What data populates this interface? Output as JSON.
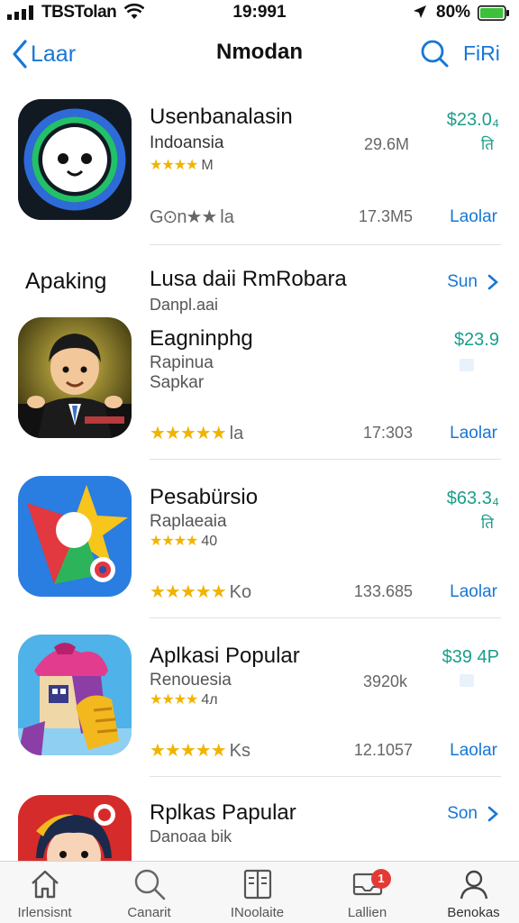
{
  "status_bar": {
    "carrier": "TBSTolan",
    "time": "19:991",
    "battery_percent": "80%",
    "icons": [
      "signal-icon",
      "wifi-icon",
      "location-icon",
      "battery-icon"
    ]
  },
  "nav": {
    "back_label": "Laar",
    "title": "Nmodan",
    "right_label": "FiRi",
    "icons": [
      "chevron-left-icon",
      "search-icon"
    ]
  },
  "apps": [
    {
      "name": "Usenbanalasin",
      "subtitle": "Indoansia",
      "rating_line": "★★★★",
      "rating_suffix": "M",
      "size_top": "29.6M",
      "price": "$23.0₄",
      "price_sub": "ति",
      "bottom_rating_stars": "G⊙n★★",
      "bottom_rating_suffix": "la",
      "size": "17.3M5",
      "action": "Laolar"
    },
    {
      "name": "Eagninphg",
      "subtitle": "Rapinua",
      "subtitle2": "Sapkar",
      "price": "$23.9",
      "bottom_rating_stars": "★★★★★",
      "bottom_rating_suffix": "la",
      "size": "17:303",
      "action": "Laolar"
    },
    {
      "name": "Pesabürsio",
      "subtitle": "Raplaeaia",
      "rating_line": "★★★★",
      "rating_suffix": "40",
      "price": "$63.3₄",
      "price_sub": "ति",
      "bottom_rating_stars": "★★★★★",
      "bottom_rating_suffix": "Ko",
      "size": "133.685",
      "action": "Laolar"
    },
    {
      "name": "Aplkasi Popular",
      "subtitle": "Renouesia",
      "rating_line": "★★★★",
      "rating_suffix": "4л",
      "size_top": "3920k",
      "price": "$39 4P",
      "bottom_rating_stars": "★★★★★",
      "bottom_rating_suffix": "Ks",
      "size": "12.1057",
      "action": "Laolar"
    },
    {
      "name": "Rplkas Papular",
      "subtitle": "Danoaa bik",
      "action": "Son"
    }
  ],
  "section": {
    "label": "Apaking",
    "name": "Lusa daii RmRobara",
    "subtitle": "Danpl.aai",
    "action": "Sun"
  },
  "tabs": [
    {
      "label": "Irlensisnt",
      "icon": "house-icon"
    },
    {
      "label": "Canarit",
      "icon": "search-icon"
    },
    {
      "label": "INoolaite",
      "icon": "book-icon"
    },
    {
      "label": "Lallien",
      "icon": "tray-icon",
      "badge": "1"
    },
    {
      "label": "Benokas",
      "icon": "person-icon"
    }
  ],
  "colors": {
    "accent": "#1677d6",
    "price": "#1a9e8a",
    "stars": "#f0b400",
    "badge": "#e53935"
  }
}
